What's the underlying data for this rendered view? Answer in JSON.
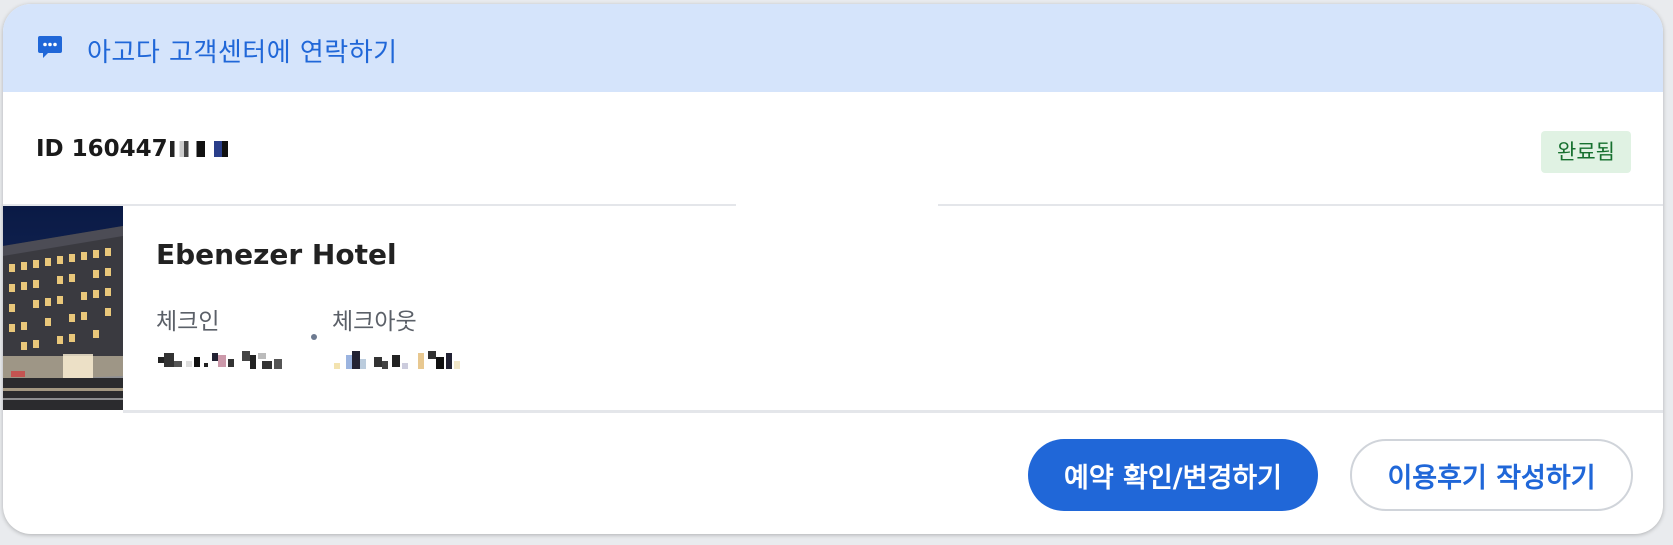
{
  "header": {
    "contact_label": "아고다 고객센터에 연락하기",
    "icon": "chat-bubble-icon"
  },
  "booking": {
    "id_prefix": "ID 160447",
    "status": "완료됨",
    "status_color": "#16702f"
  },
  "hotel": {
    "name": "Ebenezer Hotel",
    "checkin_label": "체크인",
    "checkout_label": "체크아웃"
  },
  "actions": {
    "manage_label": "예약 확인/변경하기",
    "review_label": "이용후기 작성하기"
  },
  "colors": {
    "accent": "#2067d8",
    "header_bg": "#d5e4fb",
    "badge_bg": "#e0f2e3"
  }
}
